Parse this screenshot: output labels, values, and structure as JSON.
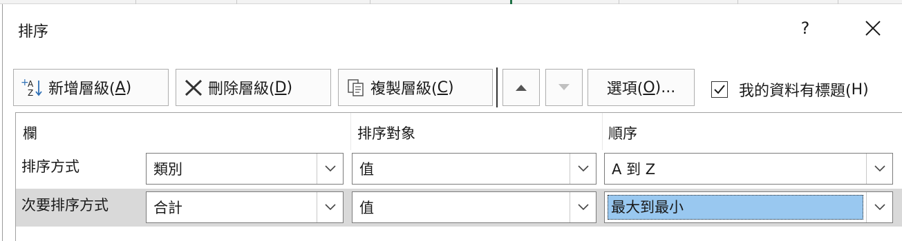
{
  "dialog": {
    "title": "排序",
    "help": "?",
    "close": "✕"
  },
  "toolbar": {
    "add_level": {
      "text": "新增層級(",
      "mnemonic": "A",
      "tail": ")",
      "icon": "add-sort-level-icon"
    },
    "delete_level": {
      "text": "刪除層級(",
      "mnemonic": "D",
      "tail": ")",
      "icon": "delete-x-icon"
    },
    "copy_level": {
      "text": "複製層級(",
      "mnemonic": "C",
      "tail": ")",
      "icon": "copy-icon"
    },
    "move_up": {
      "icon": "triangle-up-icon"
    },
    "move_down": {
      "icon": "triangle-down-icon"
    },
    "options": {
      "text": "選項(",
      "mnemonic": "O",
      "tail": ")..."
    },
    "has_headers": {
      "text": "我的資料有標題(",
      "mnemonic": "H",
      "tail": ")",
      "checked": true
    }
  },
  "grid": {
    "headers": {
      "column": "欄",
      "sort_on": "排序對象",
      "order": "順序"
    },
    "rows": [
      {
        "label": "排序方式",
        "column": "類別",
        "sort_on": "值",
        "order": "A 到 Z",
        "selected": false
      },
      {
        "label": "次要排序方式",
        "column": "合計",
        "sort_on": "值",
        "order": "最大到最小",
        "selected": true
      }
    ]
  },
  "colors": {
    "selection_row": "#d9d9d9",
    "highlight": "#99c8f0",
    "accent_green": "#1e7145"
  }
}
